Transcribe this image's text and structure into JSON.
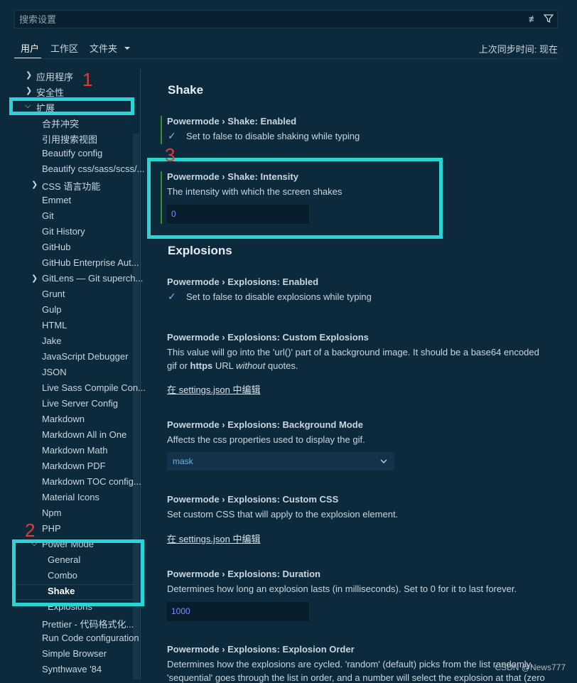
{
  "search": {
    "placeholder": "搜索设置"
  },
  "tabs": [
    "用户",
    "工作区",
    "文件夹"
  ],
  "sync_text": "上次同步时间: 现在",
  "sidebar": {
    "items": [
      {
        "label": "应用程序"
      },
      {
        "label": "安全性"
      },
      {
        "label": "扩展"
      },
      {
        "label": "合并冲突"
      },
      {
        "label": "引用搜索视图"
      },
      {
        "label": "Beautify config"
      },
      {
        "label": "Beautify css/sass/scss/..."
      },
      {
        "label": "CSS 语言功能"
      },
      {
        "label": "Emmet"
      },
      {
        "label": "Git"
      },
      {
        "label": "Git History"
      },
      {
        "label": "GitHub"
      },
      {
        "label": "GitHub Enterprise Aut..."
      },
      {
        "label": "GitLens — Git superch..."
      },
      {
        "label": "Grunt"
      },
      {
        "label": "Gulp"
      },
      {
        "label": "HTML"
      },
      {
        "label": "Jake"
      },
      {
        "label": "JavaScript Debugger"
      },
      {
        "label": "JSON"
      },
      {
        "label": "Live Sass Compile Con..."
      },
      {
        "label": "Live Server Config"
      },
      {
        "label": "Markdown"
      },
      {
        "label": "Markdown All in One"
      },
      {
        "label": "Markdown Math"
      },
      {
        "label": "Markdown PDF"
      },
      {
        "label": "Markdown TOC config..."
      },
      {
        "label": "Material Icons"
      },
      {
        "label": "Npm"
      },
      {
        "label": "PHP"
      },
      {
        "label": "Power Mode"
      },
      {
        "label": "General"
      },
      {
        "label": "Combo"
      },
      {
        "label": "Shake"
      },
      {
        "label": "Explosions"
      },
      {
        "label": "Prettier - 代码格式化..."
      },
      {
        "label": "Run Code configuration"
      },
      {
        "label": "Simple Browser"
      },
      {
        "label": "Synthwave '84"
      }
    ]
  },
  "content": {
    "shake_heading": "Shake",
    "explosions_heading": "Explosions",
    "settings": [
      {
        "title": "Powermode › Shake: Enabled",
        "desc": "Set to false to disable shaking while typing"
      },
      {
        "title": "Powermode › Shake: Intensity",
        "desc": "The intensity with which the screen shakes",
        "value": "0"
      },
      {
        "title": "Powermode › Explosions: Enabled",
        "desc": "Set to false to disable explosions while typing"
      },
      {
        "title": "Powermode › Explosions: Custom Explosions",
        "desc_a": "This value will go into the 'url()' part of a background image. It should be a base64 encoded",
        "desc_b1": "gif or ",
        "desc_b2": "https",
        "desc_b3": " URL ",
        "desc_b4": "without",
        "desc_b5": " quotes.",
        "link": "在 settings.json 中编辑"
      },
      {
        "title": "Powermode › Explosions: Background Mode",
        "desc": "Affects the css properties used to display the gif.",
        "value": "mask"
      },
      {
        "title": "Powermode › Explosions: Custom CSS",
        "desc": "Set custom CSS that will apply to the explosion element.",
        "link": "在 settings.json 中编辑"
      },
      {
        "title": "Powermode › Explosions: Duration",
        "desc": "Determines how long an explosion lasts (in milliseconds). Set to 0 for it to last forever.",
        "value": "1000"
      },
      {
        "title": "Powermode › Explosions: Explosion Order",
        "desc": "Determines how the explosions are cycled. 'random' (default) picks from the list randomly.",
        "desc2": "'sequential' goes through the list in order, and a number will select the explosion at that (zero"
      }
    ]
  },
  "annotations": [
    "1",
    "2",
    "3"
  ],
  "watermark": "CSDN @News777",
  "colors": {
    "background": "#0d2a3c",
    "highlight_box": "#2ad4d4",
    "annotation_number": "#e53935",
    "modified_bar": "#3a8c2c"
  }
}
